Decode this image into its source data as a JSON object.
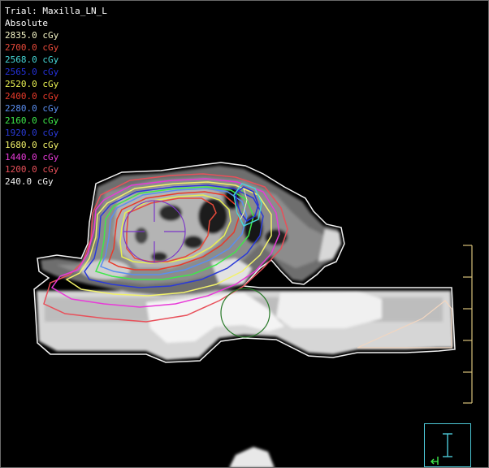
{
  "overlay": {
    "trial_label": "Trial: Maxilla_LN_L",
    "mode_label": "Absolute",
    "text_color": "#ffffff"
  },
  "isodose_legend": [
    {
      "label": "2835.0 cGy",
      "color": "#f2f2c4"
    },
    {
      "label": "2700.0 cGy",
      "color": "#e84a3a"
    },
    {
      "label": "2568.0 cGy",
      "color": "#46d6d6"
    },
    {
      "label": "2565.0 cGy",
      "color": "#2430d8"
    },
    {
      "label": "2520.0 cGy",
      "color": "#e8f052"
    },
    {
      "label": "2400.0 cGy",
      "color": "#e83a2a"
    },
    {
      "label": "2280.0 cGy",
      "color": "#5a8ef0"
    },
    {
      "label": "2160.0 cGy",
      "color": "#3ee84a"
    },
    {
      "label": "1920.0 cGy",
      "color": "#2a3ad8"
    },
    {
      "label": "1680.0 cGy",
      "color": "#f2f26a"
    },
    {
      "label": "1440.0 cGy",
      "color": "#e83ad8"
    },
    {
      "label": "1200.0 cGy",
      "color": "#e8505a"
    },
    {
      "label": "240.0 cGy",
      "color": "#f2f2f2"
    }
  ],
  "colors": {
    "background": "#000000",
    "scale_bar": "#d8c27a",
    "orientation_box": "#4cc7d6",
    "target_crosshair": "#7a36c8",
    "secondary_marker": "#2a7a2a",
    "body_contour": "#f2e6d0"
  }
}
